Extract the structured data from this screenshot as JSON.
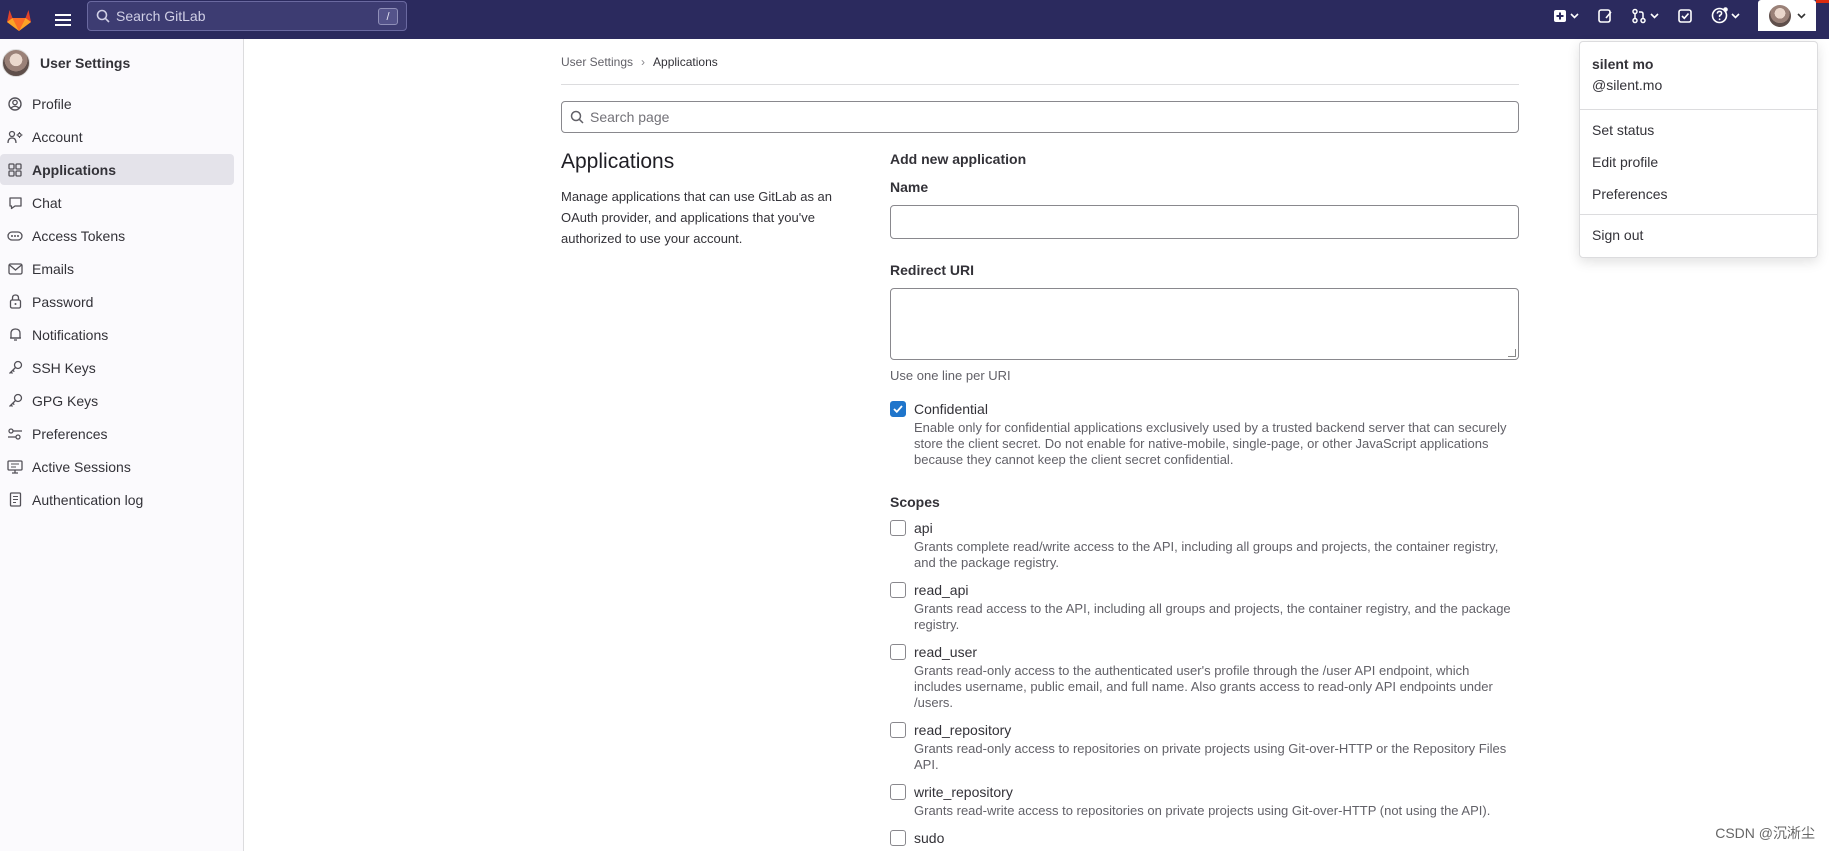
{
  "topbar": {
    "search_placeholder": "Search GitLab",
    "search_shortcut": "/"
  },
  "sidebar": {
    "title": "User Settings",
    "items": [
      {
        "label": "Profile",
        "icon": "profile-icon"
      },
      {
        "label": "Account",
        "icon": "account-icon"
      },
      {
        "label": "Applications",
        "icon": "applications-icon",
        "active": true
      },
      {
        "label": "Chat",
        "icon": "comment-icon"
      },
      {
        "label": "Access Tokens",
        "icon": "token-icon"
      },
      {
        "label": "Emails",
        "icon": "mail-icon"
      },
      {
        "label": "Password",
        "icon": "lock-icon"
      },
      {
        "label": "Notifications",
        "icon": "notifications-icon"
      },
      {
        "label": "SSH Keys",
        "icon": "key-icon"
      },
      {
        "label": "GPG Keys",
        "icon": "key-icon"
      },
      {
        "label": "Preferences",
        "icon": "preferences-icon"
      },
      {
        "label": "Active Sessions",
        "icon": "monitor-icon"
      },
      {
        "label": "Authentication log",
        "icon": "log-icon"
      }
    ]
  },
  "main": {
    "breadcrumb": [
      "User Settings",
      "Applications"
    ],
    "search_placeholder": "Search page",
    "heading": "Applications",
    "description": "Manage applications that can use GitLab as an OAuth provider, and applications that you've authorized to use your account.",
    "form": {
      "title": "Add new application",
      "name_label": "Name",
      "name_value": "",
      "redirect_label": "Redirect URI",
      "redirect_value": "",
      "redirect_help": "Use one line per URI",
      "confidential_label": "Confidential",
      "confidential_checked": true,
      "confidential_help": "Enable only for confidential applications exclusively used by a trusted backend server that can securely store the client secret. Do not enable for native-mobile, single-page, or other JavaScript applications because they cannot keep the client secret confidential.",
      "scopes_title": "Scopes",
      "scopes": [
        {
          "name": "api",
          "help": "Grants complete read/write access to the API, including all groups and projects, the container registry, and the package registry.",
          "checked": false
        },
        {
          "name": "read_api",
          "help": "Grants read access to the API, including all groups and projects, the container registry, and the package registry.",
          "checked": false
        },
        {
          "name": "read_user",
          "help": "Grants read-only access to the authenticated user's profile through the /user API endpoint, which includes username, public email, and full name. Also grants access to read-only API endpoints under /users.",
          "checked": false
        },
        {
          "name": "read_repository",
          "help": "Grants read-only access to repositories on private projects using Git-over-HTTP or the Repository Files API.",
          "checked": false
        },
        {
          "name": "write_repository",
          "help": "Grants read-write access to repositories on private projects using Git-over-HTTP (not using the API).",
          "checked": false
        },
        {
          "name": "sudo",
          "help": "",
          "checked": false
        }
      ]
    }
  },
  "user_menu": {
    "name": "silent mo",
    "handle": "@silent.mo",
    "items": [
      "Set status",
      "Edit profile",
      "Preferences"
    ],
    "sign_out": "Sign out"
  },
  "watermark": "CSDN @沉淅尘",
  "colors": {
    "topbar": "#2b2a5e",
    "accent": "#1f75cb",
    "sidebar_active": "#e4e3ea"
  }
}
